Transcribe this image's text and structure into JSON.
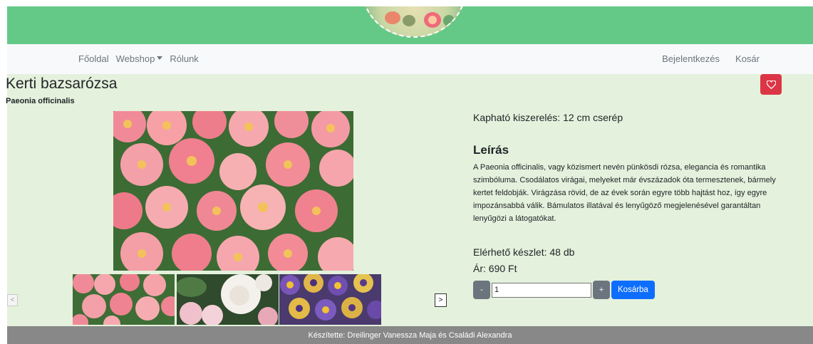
{
  "colors": {
    "header_green": "#64c987",
    "content_bg": "#e4f1dc",
    "favorite_red": "#dc3545",
    "primary_blue": "#0d6efd",
    "secondary_gray": "#6c757d",
    "footer_gray": "#888888"
  },
  "nav": {
    "home": "Főoldal",
    "webshop": "Webshop",
    "about": "Rólunk",
    "login": "Bejelentkezés",
    "cart": "Kosár"
  },
  "product": {
    "name": "Kerti bazsarózsa",
    "latin_name": "Paeonia officinalis",
    "packaging": "Kapható kiszerelés: 12 cm cserép",
    "description_title": "Leírás",
    "description": "A Paeonia officinalis, vagy közismert nevén pünkösdi rózsa, elegancia és romantika szimbóluma. Csodálatos virágai, melyeket már évszázadok óta termesztenek, bármely kertet feldobják. Virágzása rövid, de az évek során egyre több hajtást hoz, így egyre impozánsabbá válik. Bámulatos illatával és lenyűgöző megjelenésével garantáltan lenyűgözi a látogatókat.",
    "stock": "Elérhető készlet: 48 db",
    "price": "Ár: 690 Ft"
  },
  "cart_controls": {
    "minus": "-",
    "quantity": "1",
    "plus": "+",
    "add_to_cart": "Kosárba"
  },
  "gallery": {
    "prev": "<",
    "next": ">",
    "thumbnails": [
      "pink-dahlias",
      "white-peonies",
      "purple-pansies"
    ]
  },
  "icons": {
    "favorite": "heart-icon"
  },
  "footer": {
    "credits": "Készítette: Dreilinger Vanessza Maja és Családi Alexandra"
  }
}
